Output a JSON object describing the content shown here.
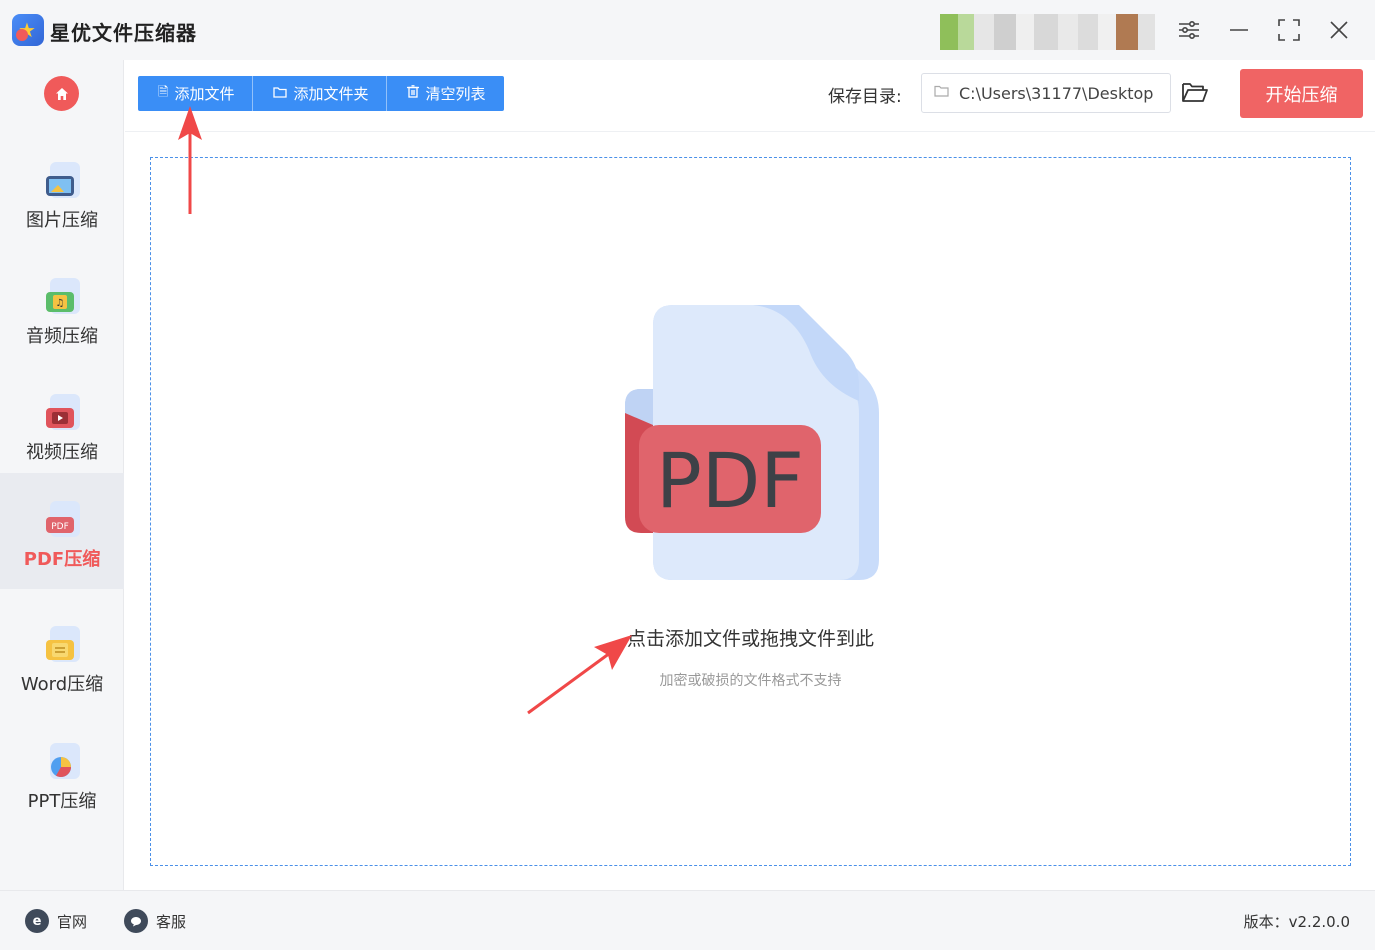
{
  "app": {
    "title": "星优文件压缩器"
  },
  "window_controls": {
    "settings": "settings-sliders-icon",
    "minimize": "minimize-icon",
    "maximize": "maximize-icon",
    "close": "close-icon"
  },
  "sidebar": {
    "items": [
      {
        "label": "图片压缩",
        "icon": "image-file-icon",
        "active": false
      },
      {
        "label": "音频压缩",
        "icon": "audio-file-icon",
        "active": false
      },
      {
        "label": "视频压缩",
        "icon": "video-file-icon",
        "active": false
      },
      {
        "label": "PDF压缩",
        "icon": "pdf-file-icon",
        "active": true
      },
      {
        "label": "Word压缩",
        "icon": "word-file-icon",
        "active": false
      },
      {
        "label": "PPT压缩",
        "icon": "ppt-file-icon",
        "active": false
      }
    ]
  },
  "toolbar": {
    "add_file": "添加文件",
    "add_folder": "添加文件夹",
    "clear_list": "清空列表",
    "save_dir_label": "保存目录:",
    "save_dir_value": "C:\\Users\\31177\\Desktop",
    "start_button": "开始压缩"
  },
  "drop_zone": {
    "badge_text": "PDF",
    "hint": "点击添加文件或拖拽文件到此",
    "sub_hint": "加密或破损的文件格式不支持"
  },
  "footer": {
    "website": "官网",
    "support": "客服",
    "version": "版本：v2.2.0.0"
  },
  "colors": {
    "accent_blue": "#3a8ef6",
    "accent_red": "#f06464",
    "pdf_red": "#e0646c"
  }
}
